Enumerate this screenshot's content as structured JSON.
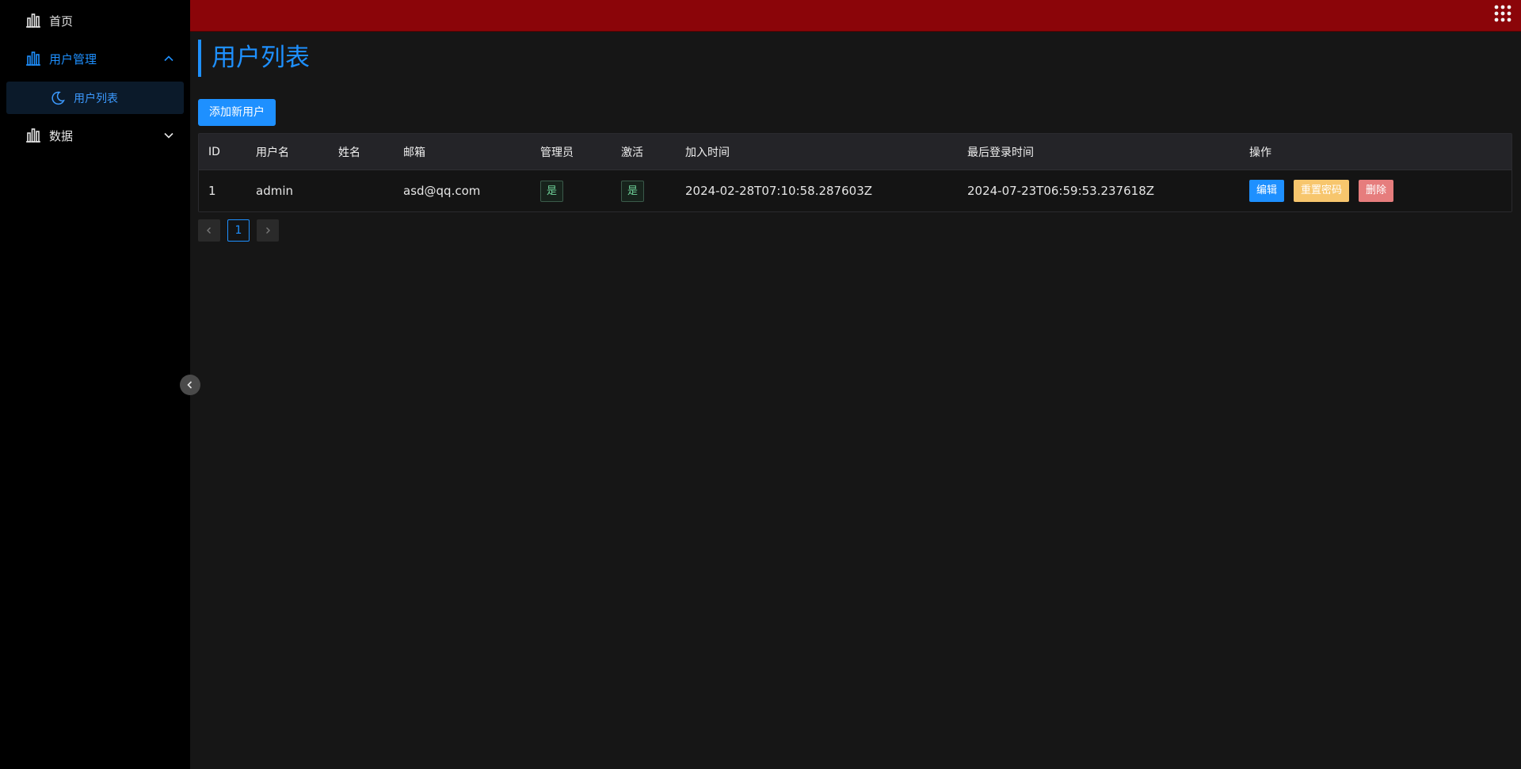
{
  "sidebar": {
    "items": [
      {
        "label": "首页",
        "icon": "bar-chart-icon"
      },
      {
        "label": "用户管理",
        "icon": "bar-chart-icon",
        "expanded": true,
        "children": [
          {
            "label": "用户列表",
            "icon": "moon-icon",
            "active": true
          }
        ]
      },
      {
        "label": "数据",
        "icon": "bar-chart-icon",
        "expanded": false
      }
    ]
  },
  "header": {
    "apps_icon": "grid-icon",
    "bar_color": "#8b0509"
  },
  "main": {
    "title": "用户列表",
    "add_button": "添加新用户",
    "table": {
      "columns": [
        "ID",
        "用户名",
        "姓名",
        "邮箱",
        "管理员",
        "激活",
        "加入时间",
        "最后登录时间",
        "操作"
      ],
      "rows": [
        {
          "id": "1",
          "username": "admin",
          "name": "",
          "email": "asd@qq.com",
          "admin": "是",
          "active": "是",
          "joined": "2024-02-28T07:10:58.287603Z",
          "last_login": "2024-07-23T06:59:53.237618Z",
          "actions": {
            "edit": "编辑",
            "reset": "重置密码",
            "delete": "删除"
          }
        }
      ]
    },
    "pagination": {
      "current": "1"
    }
  },
  "colors": {
    "accent": "#1e90ff",
    "warning": "#f7c66d",
    "danger": "#e67d7d",
    "success": "#6fd39a"
  }
}
